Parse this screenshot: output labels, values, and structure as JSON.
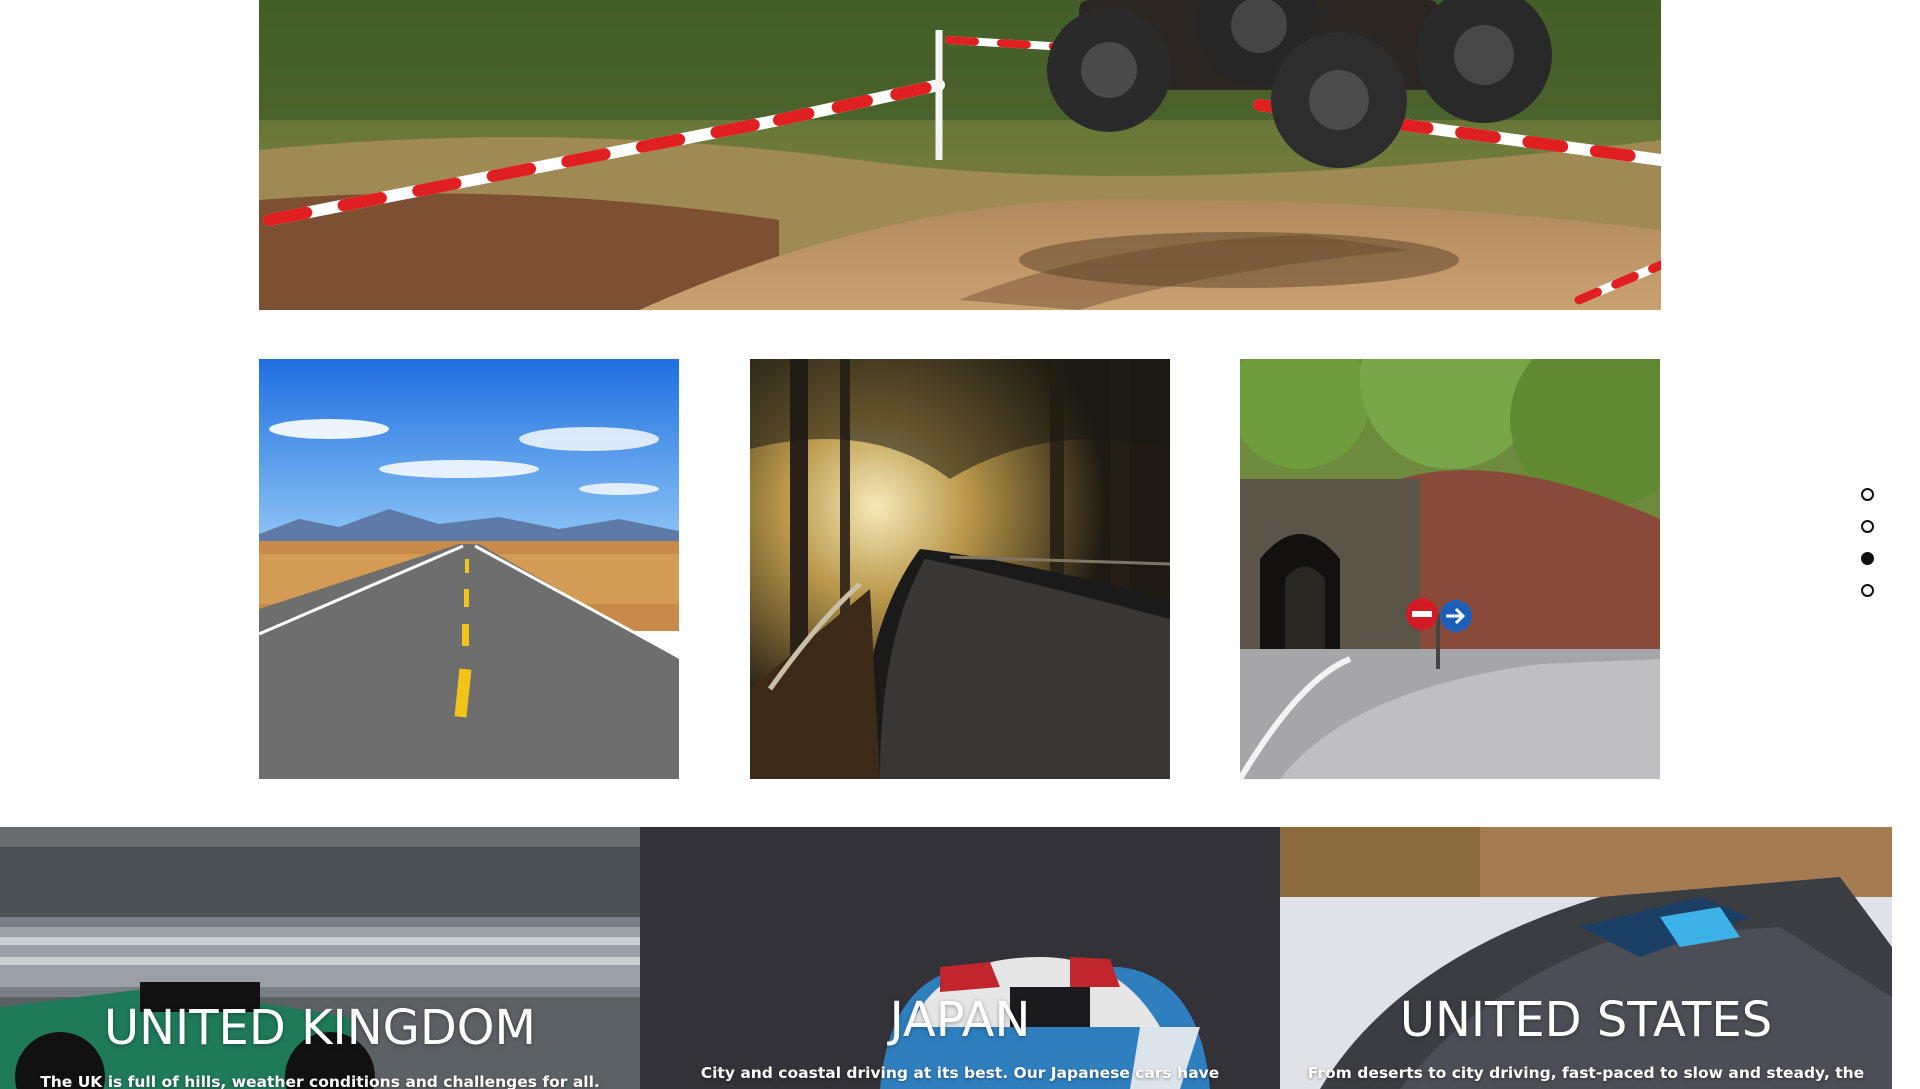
{
  "slider": {
    "dot_count": 4,
    "active_index": 2
  },
  "regions": [
    {
      "title": "UNITED KINGDOM",
      "text": "The UK is full of hills, weather conditions and challenges for all."
    },
    {
      "title": "JAPAN",
      "text": "City and coastal driving at its best. Our Japanese cars have"
    },
    {
      "title": "UNITED STATES",
      "text": "From deserts to city driving, fast-paced to slow and steady, the"
    }
  ],
  "colors": {
    "sign_red": "#d31b25",
    "sign_blue": "#1d5fb8",
    "road_line_yellow": "#f2c318",
    "jp_overlay": "#2b2b30"
  }
}
